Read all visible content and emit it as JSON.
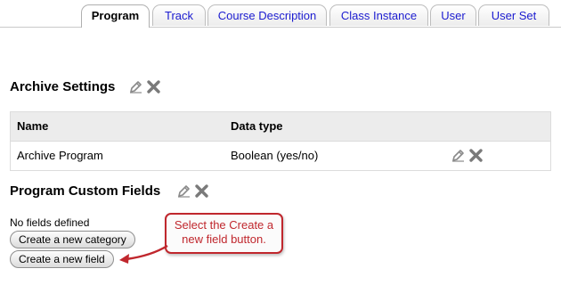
{
  "tabs": [
    {
      "label": "Program",
      "active": true
    },
    {
      "label": "Track",
      "active": false
    },
    {
      "label": "Course Description",
      "active": false
    },
    {
      "label": "Class Instance",
      "active": false
    },
    {
      "label": "User",
      "active": false
    },
    {
      "label": "User Set",
      "active": false
    }
  ],
  "archive": {
    "title": "Archive Settings",
    "table": {
      "headers": [
        "Name",
        "Data type"
      ],
      "rows": [
        {
          "name": "Archive Program",
          "data_type": "Boolean (yes/no)"
        }
      ]
    }
  },
  "custom_fields": {
    "title": "Program Custom Fields",
    "empty_text": "No fields defined",
    "create_category_label": "Create a new category",
    "create_field_label": "Create a new field"
  },
  "callout": {
    "text": "Select the Create a new field button.",
    "color": "#c0272d"
  },
  "colors": {
    "tab_link": "#1b1bd0",
    "table_header_bg": "#ececec"
  },
  "icons": [
    "edit-icon",
    "delete-icon"
  ]
}
